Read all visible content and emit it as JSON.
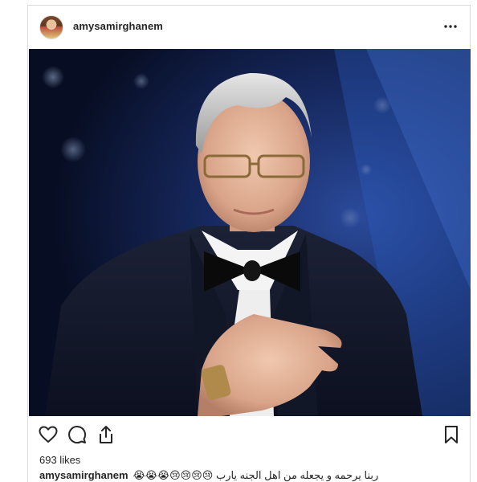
{
  "post": {
    "username": "amysamirghanem",
    "likes": "693 likes",
    "caption_user": "amysamirghanem",
    "caption_text": "ربنا يرحمه و يجعله من اهل الجنه يارب 😢😢😢😢😭😭😭"
  },
  "icons": {
    "more": "more-options-icon",
    "like": "heart-icon",
    "comment": "comment-icon",
    "share": "share-icon",
    "save": "bookmark-icon"
  },
  "colors": {
    "text": "#262626",
    "border": "#dbdbdb",
    "photo_background": "#0b1530"
  }
}
